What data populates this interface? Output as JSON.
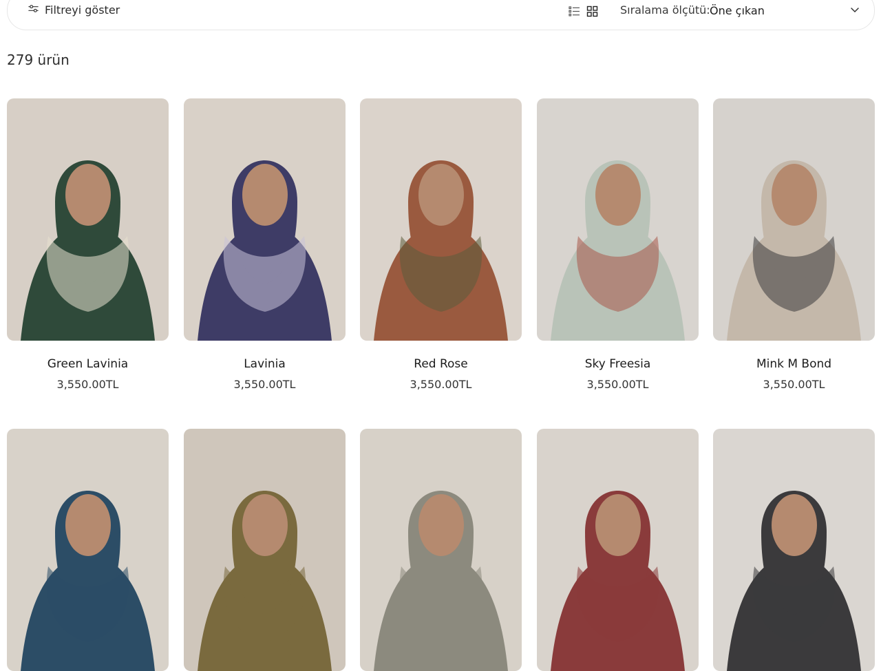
{
  "toolbar": {
    "filter_label": "Filtreyi göster",
    "sort_label": "Sıralama ölçütü:",
    "sort_value": "Öne çıkan"
  },
  "product_count": "279 ürün",
  "products": [
    {
      "name": "Green Lavinia",
      "price": "3,550.00TL",
      "bg": "#d7cfc6",
      "scarf": "#2f4a3a",
      "accent": "#e8e2d0"
    },
    {
      "name": "Lavinia",
      "price": "3,550.00TL",
      "bg": "#d9d1c8",
      "scarf": "#3e3c66",
      "accent": "#c9c2d8"
    },
    {
      "name": "Red Rose",
      "price": "3,550.00TL",
      "bg": "#dbd3cb",
      "scarf": "#9a5a3f",
      "accent": "#5b5d3c"
    },
    {
      "name": "Sky Freesia",
      "price": "3,550.00TL",
      "bg": "#d8d4cf",
      "scarf": "#b9c3b8",
      "accent": "#a9584a"
    },
    {
      "name": "Mink M Bond",
      "price": "3,550.00TL",
      "bg": "#d6d2cd",
      "scarf": "#c4b8aa",
      "accent": "#3d3b3d"
    }
  ],
  "next_row": [
    {
      "bg": "#d8d2c9",
      "scarf": "#2c4d66"
    },
    {
      "bg": "#cfc6bb",
      "scarf": "#7a6a3e"
    },
    {
      "bg": "#d7d1c8",
      "scarf": "#8c8a7e"
    },
    {
      "bg": "#d9d3cc",
      "scarf": "#8a3b3b"
    },
    {
      "bg": "#dad6d1",
      "scarf": "#3b3a3c"
    }
  ]
}
